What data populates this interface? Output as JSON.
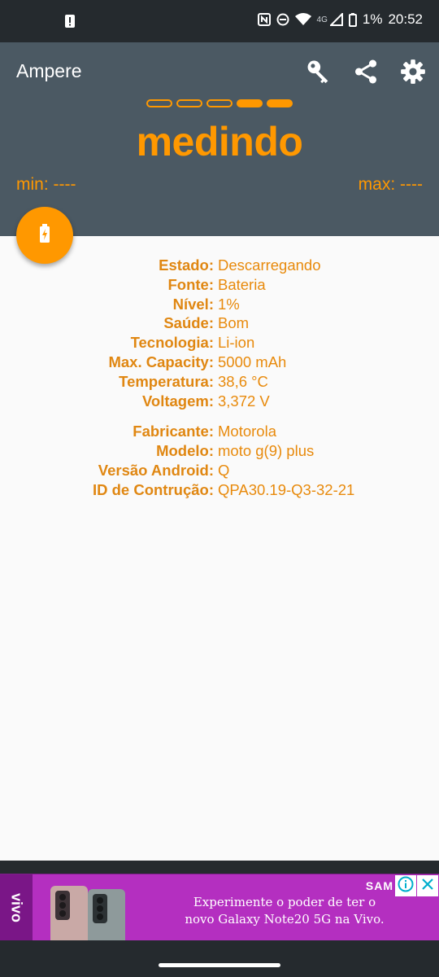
{
  "status_bar": {
    "time": "20:52",
    "battery": "1%",
    "network": "4G",
    "icons": [
      "notification-alert-icon",
      "nfc-icon",
      "do-not-disturb-icon",
      "wifi-icon",
      "signal-icon",
      "battery-icon"
    ]
  },
  "app_bar": {
    "title": "Ampere",
    "icons": [
      "key-icon",
      "share-icon",
      "gear-icon"
    ]
  },
  "measurement": {
    "status": "medindo",
    "min": "min: ----",
    "max": "max: ----",
    "progress_dots_total": 5,
    "progress_dots_filled": 2,
    "accent": "#ff9800"
  },
  "battery_info": [
    {
      "label": "Estado:",
      "value": "Descarregando"
    },
    {
      "label": "Fonte:",
      "value": "Bateria"
    },
    {
      "label": "Nível:",
      "value": "1%"
    },
    {
      "label": "Saúde:",
      "value": "Bom"
    },
    {
      "label": "Tecnologia:",
      "value": "Li-ion"
    },
    {
      "label": "Max. Capacity:",
      "value": "5000 mAh"
    },
    {
      "label": "Temperatura:",
      "value": "38,6 °C"
    },
    {
      "label": "Voltagem:",
      "value": "3,372 V"
    }
  ],
  "device_info": [
    {
      "label": "Fabricante:",
      "value": "Motorola"
    },
    {
      "label": "Modelo:",
      "value": "moto g(9) plus"
    },
    {
      "label": "Versão Android:",
      "value": "Q"
    },
    {
      "label": "ID de Contrução:",
      "value": "QPA30.19-Q3-32-21"
    }
  ],
  "ad": {
    "brand": "vivo",
    "sponsor": "SAM",
    "line1": "Experimente o poder de ter o",
    "line2": "novo Galaxy Note20 5G na Vivo."
  },
  "colors": {
    "header": "#4b5963",
    "status_bar": "#252a2e",
    "ad_background": "#b42fc0"
  }
}
